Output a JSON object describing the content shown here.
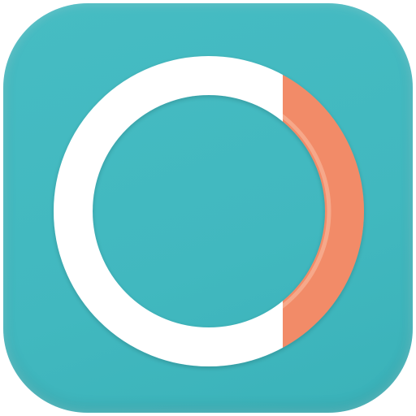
{
  "app_icon": {
    "name": "ring-progress-app-icon",
    "colors": {
      "background": "#41b8bf",
      "ring": "#ffffff",
      "accent": "#f28b67",
      "accent_highlight": "#f7ad90"
    },
    "accent_segment_fraction": 0.25
  }
}
